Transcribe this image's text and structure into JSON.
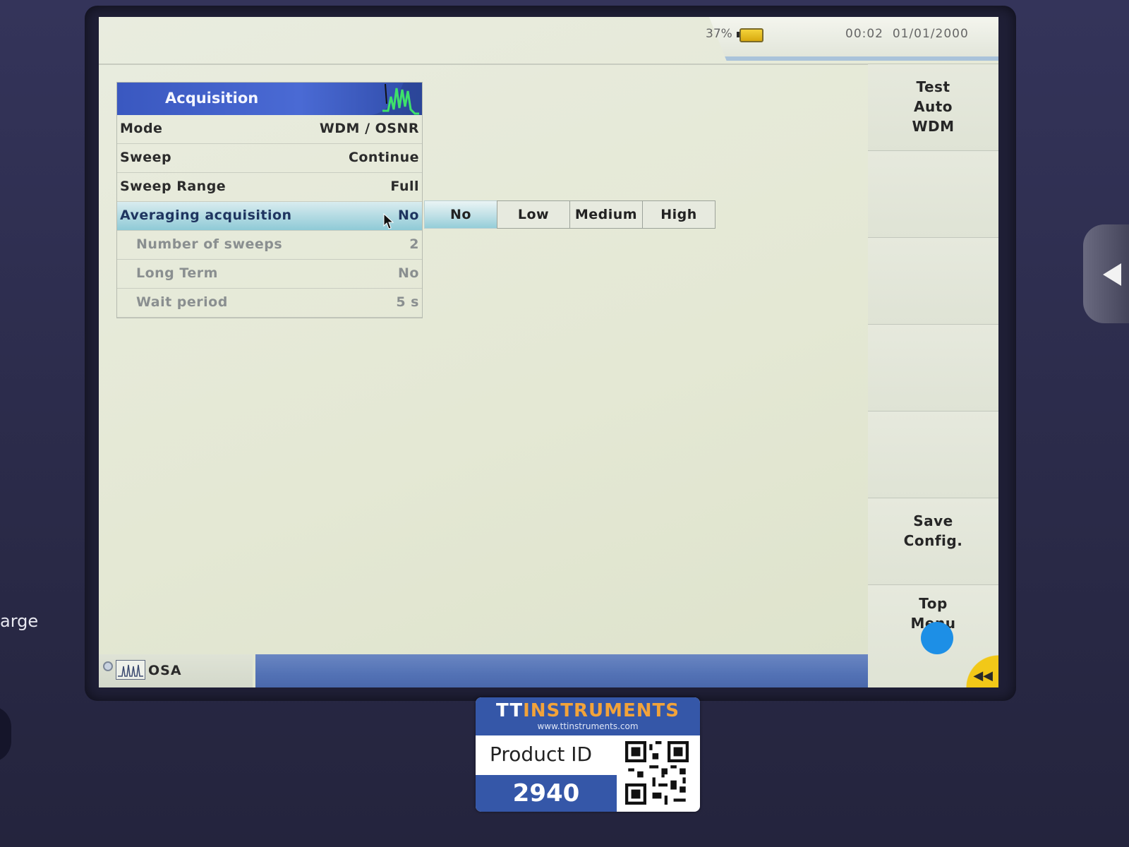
{
  "status": {
    "battery_percent": "37%",
    "time": "00:02",
    "date": "01/01/2000"
  },
  "panel": {
    "title": "Acquisition",
    "rows": [
      {
        "label": "Mode",
        "value": "WDM / OSNR"
      },
      {
        "label": "Sweep",
        "value": "Continue"
      },
      {
        "label": "Sweep Range",
        "value": "Full"
      },
      {
        "label": "Averaging acquisition",
        "value": "No"
      },
      {
        "label": "Number of sweeps",
        "value": "2"
      },
      {
        "label": "Long Term",
        "value": "No"
      },
      {
        "label": "Wait period",
        "value": "5 s"
      }
    ]
  },
  "averaging_options": [
    "No",
    "Low",
    "Medium",
    "High"
  ],
  "softkeys": {
    "test_auto_wdm": "Test\nAuto\nWDM",
    "save_config": "Save\nConfig.",
    "top_menu": "Top\nMenu"
  },
  "bottom": {
    "module": "OSA"
  },
  "device": {
    "side_text": "arge"
  },
  "sticker": {
    "brand_tt": "TT",
    "brand_rest": "INSTRUMENTS",
    "website": "www.ttinstruments.com",
    "product_label": "Product ID",
    "product_id": "2940"
  },
  "colors": {
    "header_blue": "#3a58c0",
    "selected_cyan": "#8fcad6",
    "screen_bg": "#e6e9db"
  }
}
